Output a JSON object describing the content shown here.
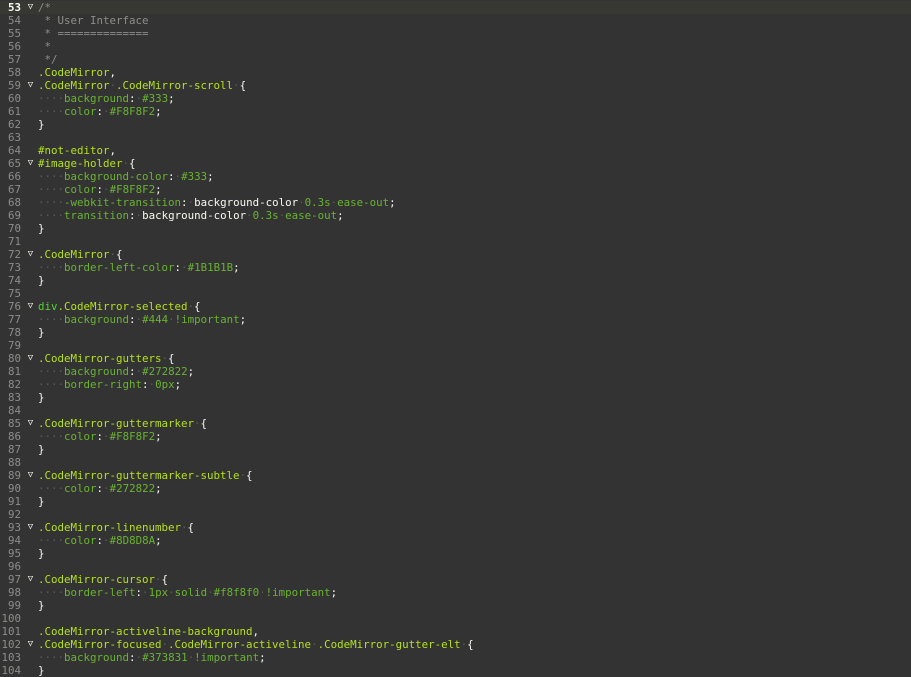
{
  "editor": {
    "theme": {
      "background": "#333333",
      "text": "#F8F8F2",
      "gutter_text": "#8D8D8A",
      "active_line": "#373831",
      "selector": "#B5E21A",
      "property": "#69B331",
      "tag": "#4FD62A",
      "comment": "#8D8D8A"
    },
    "active_line": 53,
    "fold_glyph": "▽",
    "lines": [
      {
        "n": "53",
        "fold": true,
        "tokens": [
          [
            "cm",
            "/*"
          ]
        ]
      },
      {
        "n": "54",
        "fold": false,
        "tokens": [
          [
            "cm",
            " * User Interface"
          ]
        ]
      },
      {
        "n": "55",
        "fold": false,
        "tokens": [
          [
            "cm",
            " * =============="
          ]
        ]
      },
      {
        "n": "56",
        "fold": false,
        "tokens": [
          [
            "cm",
            " *"
          ]
        ]
      },
      {
        "n": "57",
        "fold": false,
        "tokens": [
          [
            "cm",
            " */"
          ]
        ]
      },
      {
        "n": "58",
        "fold": false,
        "tokens": [
          [
            "sel",
            ".CodeMirror"
          ],
          [
            "pun",
            ","
          ]
        ]
      },
      {
        "n": "59",
        "fold": true,
        "tokens": [
          [
            "sel",
            ".CodeMirror"
          ],
          [
            "ws",
            " "
          ],
          [
            "sel",
            ".CodeMirror-scroll"
          ],
          [
            "ws",
            " "
          ],
          [
            "pun",
            "{"
          ]
        ]
      },
      {
        "n": "60",
        "fold": false,
        "tokens": [
          [
            "ws",
            "    "
          ],
          [
            "prop",
            "background"
          ],
          [
            "pun",
            ":"
          ],
          [
            "ws",
            " "
          ],
          [
            "val",
            "#333"
          ],
          [
            "pun",
            ";"
          ]
        ]
      },
      {
        "n": "61",
        "fold": false,
        "tokens": [
          [
            "ws",
            "    "
          ],
          [
            "prop",
            "color"
          ],
          [
            "pun",
            ":"
          ],
          [
            "ws",
            " "
          ],
          [
            "val",
            "#F8F8F2"
          ],
          [
            "pun",
            ";"
          ]
        ]
      },
      {
        "n": "62",
        "fold": false,
        "tokens": [
          [
            "pun",
            "}"
          ]
        ]
      },
      {
        "n": "63",
        "fold": false,
        "tokens": []
      },
      {
        "n": "64",
        "fold": false,
        "tokens": [
          [
            "sel",
            "#not-editor"
          ],
          [
            "pun",
            ","
          ]
        ]
      },
      {
        "n": "65",
        "fold": true,
        "tokens": [
          [
            "sel",
            "#image-holder"
          ],
          [
            "ws",
            " "
          ],
          [
            "pun",
            "{"
          ]
        ]
      },
      {
        "n": "66",
        "fold": false,
        "tokens": [
          [
            "ws",
            "    "
          ],
          [
            "prop",
            "background-color"
          ],
          [
            "pun",
            ":"
          ],
          [
            "ws",
            " "
          ],
          [
            "val",
            "#333"
          ],
          [
            "pun",
            ";"
          ]
        ]
      },
      {
        "n": "67",
        "fold": false,
        "tokens": [
          [
            "ws",
            "    "
          ],
          [
            "prop",
            "color"
          ],
          [
            "pun",
            ":"
          ],
          [
            "ws",
            " "
          ],
          [
            "val",
            "#F8F8F2"
          ],
          [
            "pun",
            ";"
          ]
        ]
      },
      {
        "n": "68",
        "fold": false,
        "tokens": [
          [
            "ws",
            "    "
          ],
          [
            "prop",
            "-webkit-transition"
          ],
          [
            "pun",
            ":"
          ],
          [
            "ws",
            " "
          ],
          [
            "plain",
            "background-color"
          ],
          [
            "ws",
            " "
          ],
          [
            "val",
            "0.3s"
          ],
          [
            "ws",
            " "
          ],
          [
            "val",
            "ease-out"
          ],
          [
            "pun",
            ";"
          ]
        ]
      },
      {
        "n": "69",
        "fold": false,
        "tokens": [
          [
            "ws",
            "    "
          ],
          [
            "prop",
            "transition"
          ],
          [
            "pun",
            ":"
          ],
          [
            "ws",
            " "
          ],
          [
            "plain",
            "background-color"
          ],
          [
            "ws",
            " "
          ],
          [
            "val",
            "0.3s"
          ],
          [
            "ws",
            " "
          ],
          [
            "val",
            "ease-out"
          ],
          [
            "pun",
            ";"
          ]
        ]
      },
      {
        "n": "70",
        "fold": false,
        "tokens": [
          [
            "pun",
            "}"
          ]
        ]
      },
      {
        "n": "71",
        "fold": false,
        "tokens": []
      },
      {
        "n": "72",
        "fold": true,
        "tokens": [
          [
            "sel",
            ".CodeMirror"
          ],
          [
            "ws",
            " "
          ],
          [
            "pun",
            "{"
          ]
        ]
      },
      {
        "n": "73",
        "fold": false,
        "tokens": [
          [
            "ws",
            "    "
          ],
          [
            "prop",
            "border-left-color"
          ],
          [
            "pun",
            ":"
          ],
          [
            "ws",
            " "
          ],
          [
            "val",
            "#1B1B1B"
          ],
          [
            "pun",
            ";"
          ]
        ]
      },
      {
        "n": "74",
        "fold": false,
        "tokens": [
          [
            "pun",
            "}"
          ]
        ]
      },
      {
        "n": "75",
        "fold": false,
        "tokens": []
      },
      {
        "n": "76",
        "fold": true,
        "tokens": [
          [
            "tag",
            "div"
          ],
          [
            "sel",
            ".CodeMirror-selected"
          ],
          [
            "ws",
            " "
          ],
          [
            "pun",
            "{"
          ]
        ]
      },
      {
        "n": "77",
        "fold": false,
        "tokens": [
          [
            "ws",
            "    "
          ],
          [
            "prop",
            "background"
          ],
          [
            "pun",
            ":"
          ],
          [
            "ws",
            " "
          ],
          [
            "val",
            "#444"
          ],
          [
            "ws",
            " "
          ],
          [
            "imp",
            "!important"
          ],
          [
            "pun",
            ";"
          ]
        ]
      },
      {
        "n": "78",
        "fold": false,
        "tokens": [
          [
            "pun",
            "}"
          ]
        ]
      },
      {
        "n": "79",
        "fold": false,
        "tokens": []
      },
      {
        "n": "80",
        "fold": true,
        "tokens": [
          [
            "sel",
            ".CodeMirror-gutters"
          ],
          [
            "ws",
            " "
          ],
          [
            "pun",
            "{"
          ]
        ]
      },
      {
        "n": "81",
        "fold": false,
        "tokens": [
          [
            "ws",
            "    "
          ],
          [
            "prop",
            "background"
          ],
          [
            "pun",
            ":"
          ],
          [
            "ws",
            " "
          ],
          [
            "val",
            "#272822"
          ],
          [
            "pun",
            ";"
          ]
        ]
      },
      {
        "n": "82",
        "fold": false,
        "tokens": [
          [
            "ws",
            "    "
          ],
          [
            "prop",
            "border-right"
          ],
          [
            "pun",
            ":"
          ],
          [
            "ws",
            " "
          ],
          [
            "val",
            "0px"
          ],
          [
            "pun",
            ";"
          ]
        ]
      },
      {
        "n": "83",
        "fold": false,
        "tokens": [
          [
            "pun",
            "}"
          ]
        ]
      },
      {
        "n": "84",
        "fold": false,
        "tokens": []
      },
      {
        "n": "85",
        "fold": true,
        "tokens": [
          [
            "sel",
            ".CodeMirror-guttermarker"
          ],
          [
            "ws",
            " "
          ],
          [
            "pun",
            "{"
          ]
        ]
      },
      {
        "n": "86",
        "fold": false,
        "tokens": [
          [
            "ws",
            "    "
          ],
          [
            "prop",
            "color"
          ],
          [
            "pun",
            ":"
          ],
          [
            "ws",
            " "
          ],
          [
            "val",
            "#F8F8F2"
          ],
          [
            "pun",
            ";"
          ]
        ]
      },
      {
        "n": "87",
        "fold": false,
        "tokens": [
          [
            "pun",
            "}"
          ]
        ]
      },
      {
        "n": "88",
        "fold": false,
        "tokens": []
      },
      {
        "n": "89",
        "fold": true,
        "tokens": [
          [
            "sel",
            ".CodeMirror-guttermarker-subtle"
          ],
          [
            "ws",
            " "
          ],
          [
            "pun",
            "{"
          ]
        ]
      },
      {
        "n": "90",
        "fold": false,
        "tokens": [
          [
            "ws",
            "    "
          ],
          [
            "prop",
            "color"
          ],
          [
            "pun",
            ":"
          ],
          [
            "ws",
            " "
          ],
          [
            "val",
            "#272822"
          ],
          [
            "pun",
            ";"
          ]
        ]
      },
      {
        "n": "91",
        "fold": false,
        "tokens": [
          [
            "pun",
            "}"
          ]
        ]
      },
      {
        "n": "92",
        "fold": false,
        "tokens": []
      },
      {
        "n": "93",
        "fold": true,
        "tokens": [
          [
            "sel",
            ".CodeMirror-linenumber"
          ],
          [
            "ws",
            " "
          ],
          [
            "pun",
            "{"
          ]
        ]
      },
      {
        "n": "94",
        "fold": false,
        "tokens": [
          [
            "ws",
            "    "
          ],
          [
            "prop",
            "color"
          ],
          [
            "pun",
            ":"
          ],
          [
            "ws",
            " "
          ],
          [
            "val",
            "#8D8D8A"
          ],
          [
            "pun",
            ";"
          ]
        ]
      },
      {
        "n": "95",
        "fold": false,
        "tokens": [
          [
            "pun",
            "}"
          ]
        ]
      },
      {
        "n": "96",
        "fold": false,
        "tokens": []
      },
      {
        "n": "97",
        "fold": true,
        "tokens": [
          [
            "sel",
            ".CodeMirror-cursor"
          ],
          [
            "ws",
            " "
          ],
          [
            "pun",
            "{"
          ]
        ]
      },
      {
        "n": "98",
        "fold": false,
        "tokens": [
          [
            "ws",
            "    "
          ],
          [
            "prop",
            "border-left"
          ],
          [
            "pun",
            ":"
          ],
          [
            "ws",
            " "
          ],
          [
            "val",
            "1px"
          ],
          [
            "ws",
            " "
          ],
          [
            "val",
            "solid"
          ],
          [
            "ws",
            " "
          ],
          [
            "val",
            "#f8f8f0"
          ],
          [
            "ws",
            " "
          ],
          [
            "imp",
            "!important"
          ],
          [
            "pun",
            ";"
          ]
        ]
      },
      {
        "n": "99",
        "fold": false,
        "tokens": [
          [
            "pun",
            "}"
          ]
        ]
      },
      {
        "n": "100",
        "fold": false,
        "tokens": []
      },
      {
        "n": "101",
        "fold": false,
        "tokens": [
          [
            "sel",
            ".CodeMirror-activeline-background"
          ],
          [
            "pun",
            ","
          ]
        ]
      },
      {
        "n": "102",
        "fold": true,
        "tokens": [
          [
            "sel",
            ".CodeMirror-focused"
          ],
          [
            "ws",
            " "
          ],
          [
            "sel",
            ".CodeMirror-activeline"
          ],
          [
            "ws",
            " "
          ],
          [
            "sel",
            ".CodeMirror-gutter-elt"
          ],
          [
            "ws",
            " "
          ],
          [
            "pun",
            "{"
          ]
        ]
      },
      {
        "n": "103",
        "fold": false,
        "tokens": [
          [
            "ws",
            "    "
          ],
          [
            "prop",
            "background"
          ],
          [
            "pun",
            ":"
          ],
          [
            "ws",
            " "
          ],
          [
            "val",
            "#373831"
          ],
          [
            "ws",
            " "
          ],
          [
            "imp",
            "!important"
          ],
          [
            "pun",
            ";"
          ]
        ]
      },
      {
        "n": "104",
        "fold": false,
        "tokens": [
          [
            "pun",
            "}"
          ]
        ]
      }
    ]
  }
}
